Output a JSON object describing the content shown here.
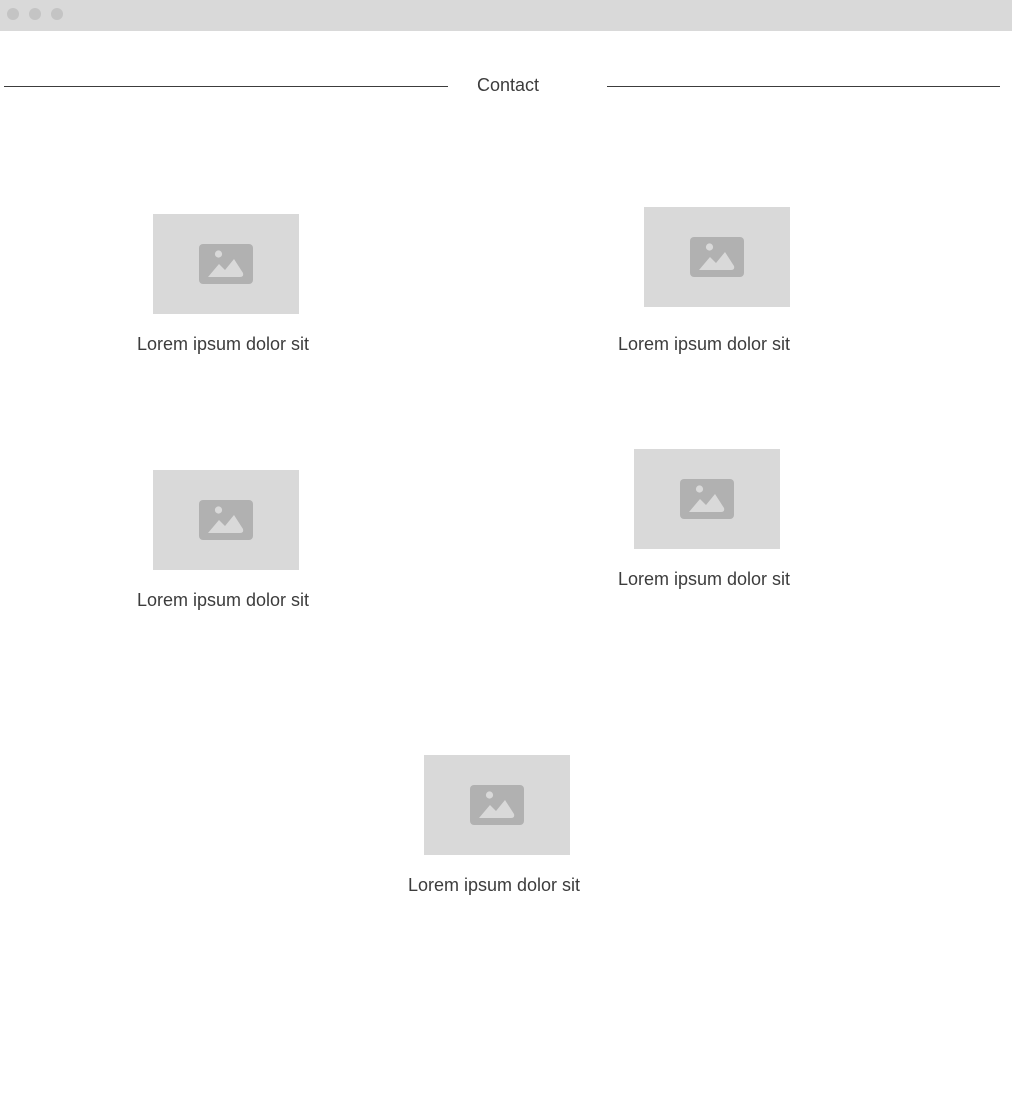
{
  "header": {
    "title": "Contact"
  },
  "items": [
    {
      "caption": "Lorem ipsum dolor sit",
      "icon": "image-icon"
    },
    {
      "caption": "Lorem ipsum dolor sit",
      "icon": "image-icon"
    },
    {
      "caption": "Lorem ipsum dolor sit",
      "icon": "image-icon"
    },
    {
      "caption": "Lorem ipsum dolor sit",
      "icon": "image-icon"
    },
    {
      "caption": "Lorem ipsum dolor sit",
      "icon": "image-icon"
    }
  ],
  "colors": {
    "titlebar": "#d9d9d9",
    "placeholder": "#d9d9d9",
    "icon": "#b1b1b1",
    "text": "#3c3c3c"
  }
}
